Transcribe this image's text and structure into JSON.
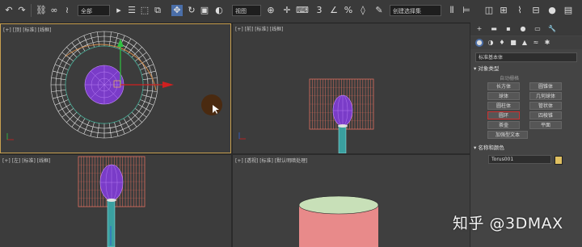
{
  "toolbar": {
    "selection_filter": "全部",
    "view_dropdown": "视图",
    "named_selection": "创建选择集"
  },
  "viewports": {
    "top": "[+] [顶] [标准] [线框]",
    "front": "[+] [前] [标准] [线框]",
    "left": "[+] [左] [标准] [线框]",
    "perspective": "[+] [透视] [标准] [默认明暗处理]"
  },
  "command_panel": {
    "category_dropdown": "标准基本体",
    "object_type_title": "对象类型",
    "autogrid": "自动栅格",
    "buttons": [
      "长方体",
      "圆锥体",
      "球体",
      "几何球体",
      "圆柱体",
      "管状体",
      "圆环",
      "四棱锥",
      "茶壶",
      "平面",
      "加强型文本"
    ],
    "name_color_title": "名称和颜色",
    "object_name": "Torus001",
    "object_color": "#e0c060"
  },
  "watermark": "知乎 @3DMAX",
  "colors": {
    "active_border": "#c8a050",
    "highlight_button": "#d03030"
  }
}
